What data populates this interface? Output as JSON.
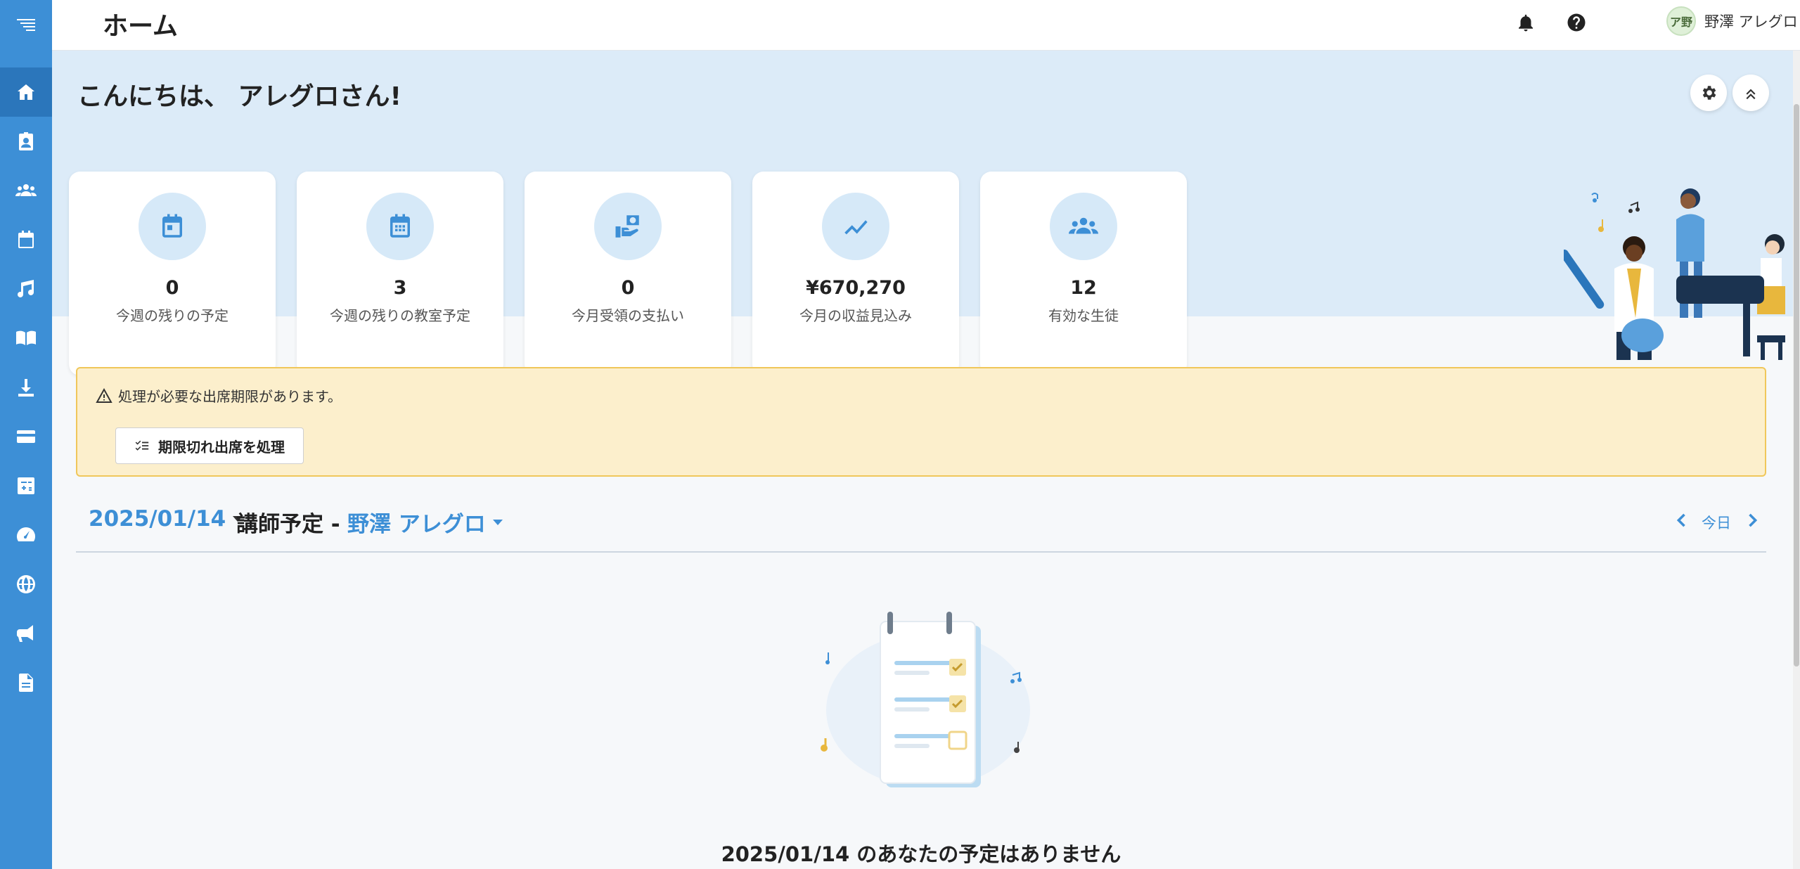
{
  "header": {
    "page_title": "ホーム",
    "user_initials": "ア野",
    "user_name": "野澤 アレグロ"
  },
  "sidebar": {
    "items": [
      {
        "icon": "menu-logo-icon"
      },
      {
        "icon": "home-icon",
        "active": true
      },
      {
        "icon": "contact-card-icon"
      },
      {
        "icon": "people-icon"
      },
      {
        "icon": "calendar-icon"
      },
      {
        "icon": "music-note-icon"
      },
      {
        "icon": "book-icon"
      },
      {
        "icon": "download-icon"
      },
      {
        "icon": "credit-card-icon"
      },
      {
        "icon": "calculator-icon"
      },
      {
        "icon": "speedometer-icon"
      },
      {
        "icon": "globe-icon"
      },
      {
        "icon": "megaphone-icon"
      },
      {
        "icon": "document-icon"
      }
    ]
  },
  "hero": {
    "greeting": "こんにちは、 アレグロさん!"
  },
  "stats": [
    {
      "icon": "calendar-icon",
      "value": "0",
      "label": "今週の残りの予定"
    },
    {
      "icon": "calendar-grid-icon",
      "value": "3",
      "label": "今週の残りの教室予定"
    },
    {
      "icon": "payment-hand-icon",
      "value": "0",
      "label": "今月受領の支払い"
    },
    {
      "icon": "trend-up-icon",
      "value": "¥670,270",
      "label": "今月の収益見込み"
    },
    {
      "icon": "group-icon",
      "value": "12",
      "label": "有効な生徒"
    }
  ],
  "alert": {
    "message": "処理が必要な出席期限があります。",
    "button_label": "期限切れ出席を処理"
  },
  "schedule": {
    "date": "2025/01/14",
    "title": "講師予定 -",
    "teacher": "野澤 アレグロ",
    "today_label": "今日",
    "empty_message": "2025/01/14 のあなたの予定はありません"
  },
  "colors": {
    "sidebar": "#3d8fd6",
    "hero_bg": "#dcebf8",
    "accent": "#3d8fd6",
    "alert_bg": "#fcefcc",
    "alert_border": "#f0c75a"
  }
}
